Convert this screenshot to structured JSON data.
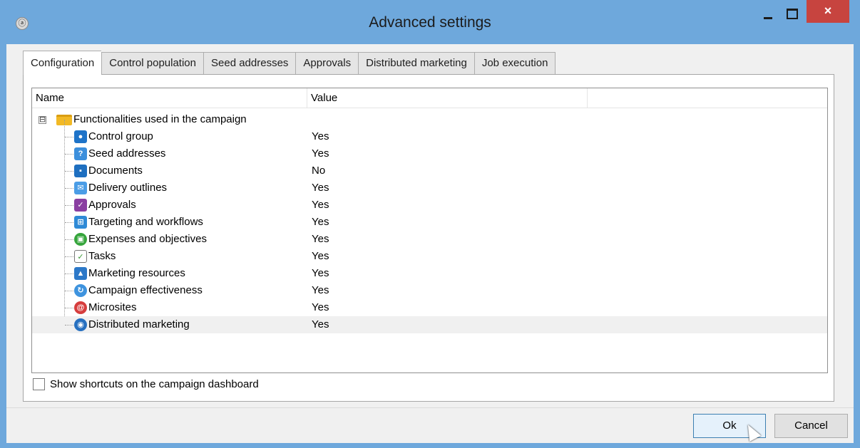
{
  "window": {
    "title": "Advanced settings",
    "app_icon": "app-logo-icon",
    "controls": {
      "minimize": "minimize-icon",
      "maximize": "maximize-icon",
      "close": "×"
    }
  },
  "tabs": [
    {
      "label": "Configuration",
      "active": true
    },
    {
      "label": "Control population",
      "active": false
    },
    {
      "label": "Seed addresses",
      "active": false
    },
    {
      "label": "Approvals",
      "active": false
    },
    {
      "label": "Distributed marketing",
      "active": false
    },
    {
      "label": "Job execution",
      "active": false
    }
  ],
  "table": {
    "columns": [
      "Name",
      "Value"
    ],
    "root": {
      "label": "Functionalities used in the campaign",
      "expander": "⊟",
      "icon": "folder-icon"
    },
    "items": [
      {
        "label": "Control group",
        "value": "Yes",
        "icon": "control-group-icon"
      },
      {
        "label": "Seed addresses",
        "value": "Yes",
        "icon": "seed-addresses-icon"
      },
      {
        "label": "Documents",
        "value": "No",
        "icon": "documents-icon"
      },
      {
        "label": "Delivery outlines",
        "value": "Yes",
        "icon": "delivery-outlines-icon"
      },
      {
        "label": "Approvals",
        "value": "Yes",
        "icon": "approvals-icon"
      },
      {
        "label": "Targeting and workflows",
        "value": "Yes",
        "icon": "workflow-icon"
      },
      {
        "label": "Expenses and objectives",
        "value": "Yes",
        "icon": "expenses-icon"
      },
      {
        "label": "Tasks",
        "value": "Yes",
        "icon": "tasks-icon"
      },
      {
        "label": "Marketing resources",
        "value": "Yes",
        "icon": "marketing-resources-icon"
      },
      {
        "label": "Campaign effectiveness",
        "value": "Yes",
        "icon": "campaign-effectiveness-icon"
      },
      {
        "label": "Microsites",
        "value": "Yes",
        "icon": "microsites-icon"
      },
      {
        "label": "Distributed marketing",
        "value": "Yes",
        "icon": "distributed-marketing-icon",
        "selected": true
      }
    ]
  },
  "checkbox": {
    "label": "Show shortcuts on the campaign dashboard",
    "checked": false
  },
  "buttons": {
    "ok": "Ok",
    "cancel": "Cancel"
  },
  "colors": {
    "titlebar": "#6ea8dc",
    "close_button": "#c7443f",
    "folder": "#f2b925",
    "selected_row": "#f0f0f0"
  }
}
